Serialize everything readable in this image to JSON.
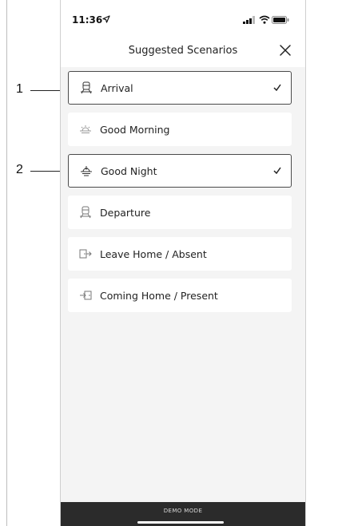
{
  "status_bar": {
    "time": "11:36"
  },
  "header": {
    "title": "Suggested Scenarios"
  },
  "scenarios": [
    {
      "label": "Arrival",
      "icon": "arrival-icon",
      "selected": true
    },
    {
      "label": "Good Morning",
      "icon": "sunrise-icon",
      "selected": false
    },
    {
      "label": "Good Night",
      "icon": "sunset-icon",
      "selected": true
    },
    {
      "label": "Departure",
      "icon": "departure-icon",
      "selected": false
    },
    {
      "label": "Leave Home / Absent",
      "icon": "leave-home-icon",
      "selected": false
    },
    {
      "label": "Coming Home / Present",
      "icon": "coming-home-icon",
      "selected": false
    }
  ],
  "footer": {
    "label": "DEMO MODE"
  },
  "callouts": [
    "1",
    "2"
  ],
  "colors": {
    "selected_border": "#4a4a4a",
    "footer_bg": "#2b2b2b",
    "screen_bg": "#f4f4f4"
  }
}
